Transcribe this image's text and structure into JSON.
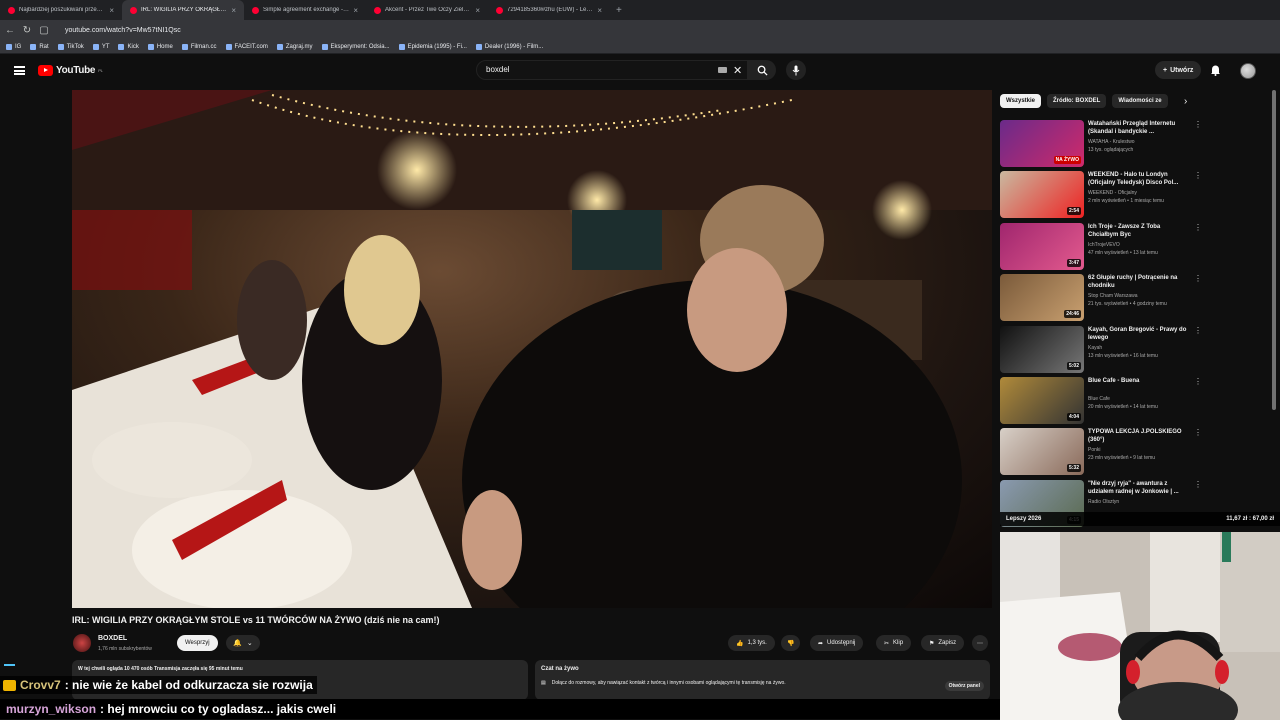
{
  "browser": {
    "tabs": [
      {
        "label": "Najbardziej poszukiwani przestępcy",
        "active": false
      },
      {
        "label": "IRL: WIGILIA PRZY OKRĄGŁYM",
        "active": true
      },
      {
        "label": "Simple agreement exchange - Go",
        "active": false
      },
      {
        "label": "Akcent - Przez Twe Oczy Zielone (Of",
        "active": false
      },
      {
        "label": "7294185360ł#zhu (EUW) - LeagueO",
        "active": false
      }
    ],
    "url": "youtube.com/watch?v=Mw57tNI1Qsc",
    "bookmarks": [
      "IG",
      "Rat",
      "TikTok",
      "YT",
      "Kick",
      "Home",
      "Filman.cc",
      "FACEIT.com",
      "Zagraj.my",
      "Eksperyment: Odsia...",
      "Epidemia (1995) - Fi...",
      "Dealer (1996) - Film..."
    ]
  },
  "youtube": {
    "logo_text": "YouTube",
    "region": "PL",
    "search_value": "boxdel",
    "create_label": "Utwórz"
  },
  "video": {
    "title": "IRL: WIGILIA PRZY OKRĄGŁYM STOLE vs 11 TWÓRCÓW NA ŻYWO (dziś nie na cam!)",
    "channel": "BOXDEL",
    "subscribers": "1,76 mln subskrybentów",
    "support_label": "Wesprzyj",
    "likes": "1,3 tys.",
    "share_label": "Udostępnij",
    "clip_label": "Klip",
    "save_label": "Zapisz",
    "info_line1": "W tej chwili ogląda 10 470 osób  Transmisja zaczęła się 95 minut temu",
    "chat_title": "Czat na żywo",
    "chat_desc": "Dołącz do rozmowy, aby nawiązać kontakt z twórcą i innymi osobami oglądającymi tę transmisję na żywo.",
    "open_panel_label": "Otwórz panel"
  },
  "sidebar": {
    "chips": [
      "Wszystkie",
      "Źródło: BOXDEL",
      "Wiadomości ze"
    ],
    "recs": [
      {
        "title": "Watahański Przegląd Internetu (Skandal i bandyckie ...",
        "channel": "WATAHA - Krulestwo",
        "meta": "13 tys. oglądających",
        "dur": "NA ŻYWO",
        "live": true,
        "c1": "#6a2a8a",
        "c2": "#d02a6a"
      },
      {
        "title": "WEEKEND - Halo tu Londyn (Oficjalny Teledysk) Disco Pol...",
        "channel": "WEEKEND - Oficjalny",
        "meta": "2 mln wyświetleń • 1 miesiąc temu",
        "dur": "2:54",
        "live": false,
        "c1": "#c9b9a0",
        "c2": "#e22"
      },
      {
        "title": "Ich Troje - Zawsze Z Toba Chciałbym Byc",
        "channel": "IchTrojeVEVO",
        "meta": "47 mln wyświetleń • 13 lat temu",
        "dur": "3:47",
        "live": false,
        "c1": "#a0266e",
        "c2": "#e35a8e"
      },
      {
        "title": "62 Głupie ruchy | Potrącenie na chodniku",
        "channel": "Stop Cham Warszawa",
        "meta": "21 tys. wyświetleń • 4 godziny temu",
        "dur": "24:46",
        "live": false,
        "c1": "#7a5a3a",
        "c2": "#c9a070"
      },
      {
        "title": "Kayah, Goran Bregović - Prawy do lewego",
        "channel": "Kayah",
        "meta": "13 mln wyświetleń • 16 lat temu",
        "dur": "5:02",
        "live": false,
        "c1": "#111",
        "c2": "#777"
      },
      {
        "title": "Blue Cafe - Buena",
        "channel": "Blue Cafe",
        "meta": "20 mln wyświetleń • 14 lat temu",
        "dur": "4:04",
        "live": false,
        "c1": "#b08a3a",
        "c2": "#333"
      },
      {
        "title": "TYPOWA LEKCJA J.POLSKIEGO (360°)",
        "channel": "Ponki",
        "meta": "23 mln wyświetleń • 9 lat temu",
        "dur": "5:32",
        "live": false,
        "c1": "#d8d0c8",
        "c2": "#8a6a5a"
      },
      {
        "title": "\"Nie drzyj ryja\" - awantura z udziałem radnej w Jonkowie | ...",
        "channel": "Radio Olsztyn",
        "meta": "",
        "dur": "4:15",
        "live": false,
        "c1": "#8a9ab0",
        "c2": "#5a6a50"
      }
    ],
    "overlay_left": "Lepszy 2026",
    "overlay_right": "11,67 zł : 67,00 zł"
  },
  "chat": [
    {
      "user": "Crovv7",
      "message": ": nie wie że kabel od odkurzacza sie rozwija"
    },
    {
      "user": "murzyn_wikson",
      "message": ": hej mrowciu co ty ogladasz... jakis cweli"
    }
  ]
}
